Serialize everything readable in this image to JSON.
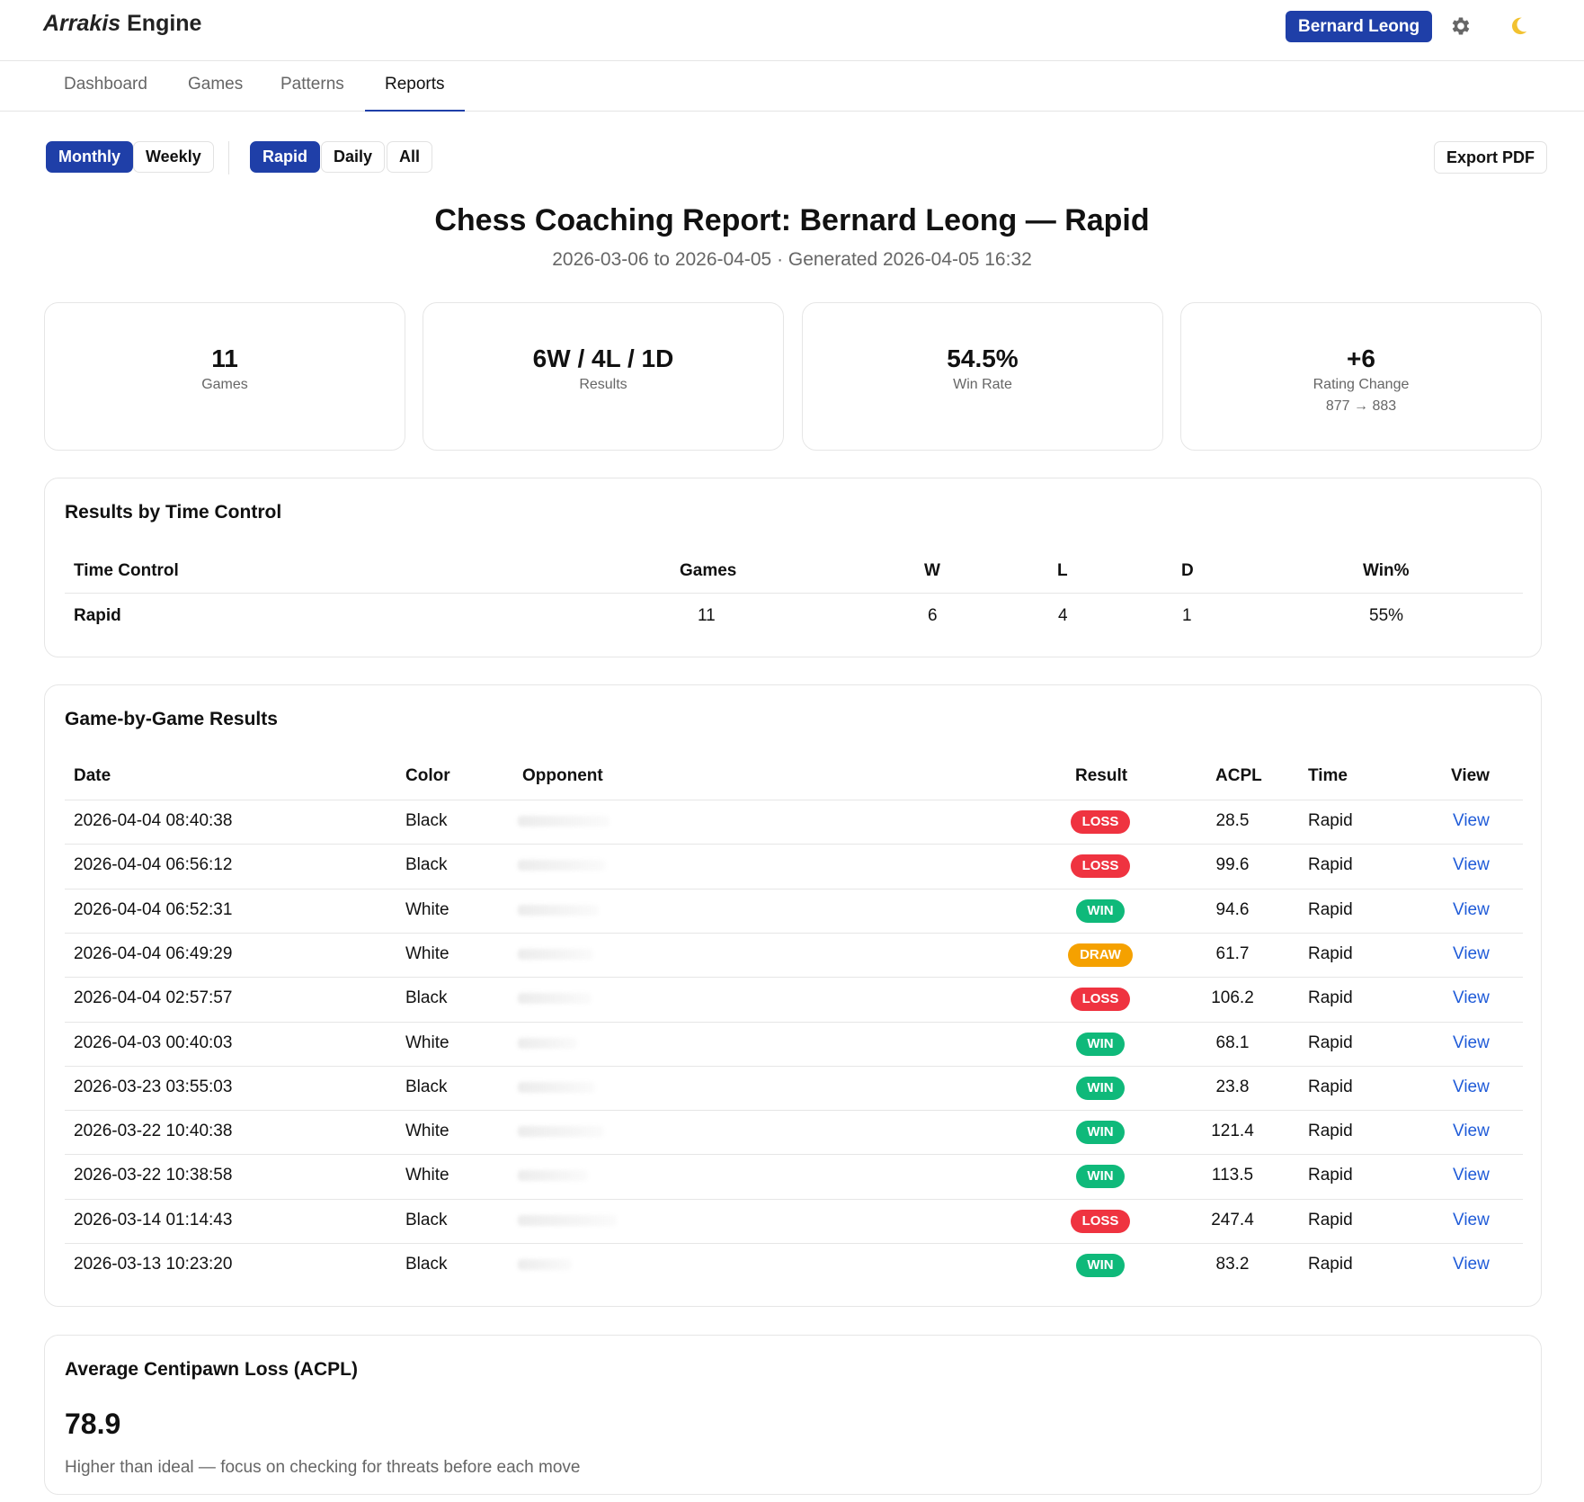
{
  "app": {
    "brand_italic": "Arrakis",
    "brand_rest": " Engine",
    "user_button": "Bernard Leong",
    "settings_icon": "gear-icon",
    "theme_icon": "moon-icon"
  },
  "tabs": [
    {
      "label": "Dashboard",
      "active": false
    },
    {
      "label": "Games",
      "active": false
    },
    {
      "label": "Patterns",
      "active": false
    },
    {
      "label": "Reports",
      "active": true
    }
  ],
  "filters": {
    "period": [
      {
        "label": "Monthly",
        "selected": true
      },
      {
        "label": "Weekly",
        "selected": false
      }
    ],
    "time_control": [
      {
        "label": "Rapid",
        "selected": true
      },
      {
        "label": "Daily",
        "selected": false
      },
      {
        "label": "All",
        "selected": false
      }
    ],
    "export_label": "Export PDF"
  },
  "report": {
    "title": "Chess Coaching Report: Bernard Leong — Rapid",
    "subtitle": "2026-03-06 to 2026-04-05 · Generated 2026-04-05 16:32"
  },
  "stats": [
    {
      "value": "11",
      "label": "Games",
      "sub": ""
    },
    {
      "value": "6W / 4L / 1D",
      "label": "Results",
      "sub": ""
    },
    {
      "value": "54.5%",
      "label": "Win Rate",
      "sub": ""
    },
    {
      "value": "+6",
      "label": "Rating Change",
      "sub": "877 → 883"
    }
  ],
  "time_control_panel": {
    "title": "Results by Time Control",
    "headers": [
      "Time Control",
      "Games",
      "W",
      "L",
      "D",
      "Win%"
    ],
    "rows": [
      [
        "Rapid",
        "11",
        "6",
        "4",
        "1",
        "55%"
      ]
    ]
  },
  "games_panel": {
    "title": "Game-by-Game Results",
    "headers": [
      "Date",
      "Color",
      "Opponent",
      "Result",
      "ACPL",
      "Time",
      "View"
    ],
    "rows": [
      {
        "date": "2026-04-04 08:40:38",
        "color": "Black",
        "result": "LOSS",
        "acpl": "28.5",
        "time": "Rapid",
        "view": "View"
      },
      {
        "date": "2026-04-04 06:56:12",
        "color": "Black",
        "result": "LOSS",
        "acpl": "99.6",
        "time": "Rapid",
        "view": "View"
      },
      {
        "date": "2026-04-04 06:52:31",
        "color": "White",
        "result": "WIN",
        "acpl": "94.6",
        "time": "Rapid",
        "view": "View"
      },
      {
        "date": "2026-04-04 06:49:29",
        "color": "White",
        "result": "DRAW",
        "acpl": "61.7",
        "time": "Rapid",
        "view": "View"
      },
      {
        "date": "2026-04-04 02:57:57",
        "color": "Black",
        "result": "LOSS",
        "acpl": "106.2",
        "time": "Rapid",
        "view": "View"
      },
      {
        "date": "2026-04-03 00:40:03",
        "color": "White",
        "result": "WIN",
        "acpl": "68.1",
        "time": "Rapid",
        "view": "View"
      },
      {
        "date": "2026-03-23 03:55:03",
        "color": "Black",
        "result": "WIN",
        "acpl": "23.8",
        "time": "Rapid",
        "view": "View"
      },
      {
        "date": "2026-03-22 10:40:38",
        "color": "White",
        "result": "WIN",
        "acpl": "121.4",
        "time": "Rapid",
        "view": "View"
      },
      {
        "date": "2026-03-22 10:38:58",
        "color": "White",
        "result": "WIN",
        "acpl": "113.5",
        "time": "Rapid",
        "view": "View"
      },
      {
        "date": "2026-03-14 01:14:43",
        "color": "Black",
        "result": "LOSS",
        "acpl": "247.4",
        "time": "Rapid",
        "view": "View"
      },
      {
        "date": "2026-03-13 10:23:20",
        "color": "Black",
        "result": "WIN",
        "acpl": "83.2",
        "time": "Rapid",
        "view": "View"
      }
    ]
  },
  "acpl_panel": {
    "title": "Average Centipawn Loss (ACPL)",
    "value": "78.9",
    "note": "Higher than ideal — focus on checking for threats before each move"
  },
  "colors": {
    "accent": "#1f3fa8",
    "loss": "#ef3340",
    "win": "#0fb97a",
    "draw": "#f5a100",
    "link": "#1f5bd8"
  }
}
